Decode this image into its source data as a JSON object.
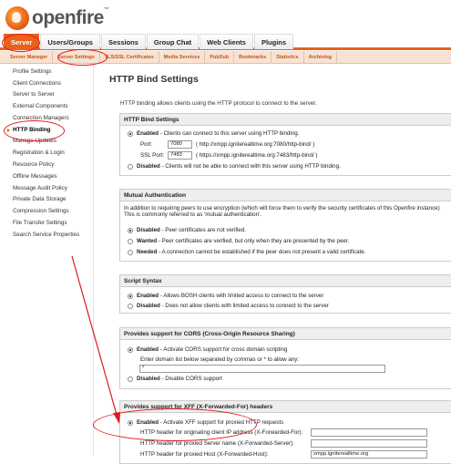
{
  "app": {
    "logo_text": "openfire",
    "logo_tm": "™"
  },
  "main_tabs": [
    "Server",
    "Users/Groups",
    "Sessions",
    "Group Chat",
    "Web Clients",
    "Plugins"
  ],
  "sub_tabs": [
    "Server Manager",
    "Server Settings",
    "TLS/SSL Certificates",
    "Media Services",
    "PubSub",
    "Bookmarks",
    "Statistics",
    "Archiving"
  ],
  "sidebar": {
    "items": [
      "Profile Settings",
      "Client Connections",
      "Server to Server",
      "External Components",
      "Connection Managers",
      "HTTP Binding",
      "Manage Updates",
      "Registration & Login",
      "Resource Policy",
      "Offline Messages",
      "Message Audit Policy",
      "Private Data Storage",
      "Compression Settings",
      "File Transfer Settings",
      "Search Service Properties"
    ]
  },
  "page": {
    "title": "HTTP Bind Settings",
    "intro": "HTTP binding allows clients using the HTTP protocol to connect to the server."
  },
  "http_bind": {
    "header": "HTTP Bind Settings",
    "enabled_label": "Enabled",
    "enabled_desc": " - Clients can connect to this server using HTTP binding.",
    "port_label": "Port:",
    "port_value": "7080",
    "port_url": "( http://xmpp.igniterealtime.org:7080/http-bind/ )",
    "ssl_port_label": "SSL Port:",
    "ssl_port_value": "7483",
    "ssl_port_url": "( https://xmpp.igniterealtime.org:7483/http-bind/ )",
    "disabled_label": "Disabled",
    "disabled_desc": " - Clients will not be able to connect with this server using HTTP binding."
  },
  "mutual_auth": {
    "header": "Mutual Authentication",
    "desc_line1": "In addition to requiring peers to use encryption (which will force them to verify the security certificates of this Openfire instance)",
    "desc_line2": "This is commonly referred to as 'mutual authentication'.",
    "disabled_label": "Disabled",
    "disabled_desc": " - Peer certificates are not verified.",
    "wanted_label": "Wanted",
    "wanted_desc": " - Peer certificates are verified, but only when they are presented by the peer.",
    "needed_label": "Needed",
    "needed_desc": " - A connection cannot be established if the peer does not present a valid certificate."
  },
  "script_syntax": {
    "header": "Script Syntax",
    "enabled_label": "Enabled",
    "enabled_desc": " - Allows BOSH clients with limited access to connect to the server",
    "disabled_label": "Disabled",
    "disabled_desc": " - Does not allow clients with limited access to connect to the server"
  },
  "cors": {
    "header": "Provides support for CORS (Cross-Origin Resource Sharing)",
    "enabled_label": "Enabled",
    "enabled_desc": " - Activate CORS support for cross domain scripting",
    "domain_prompt": "Enter domain list below separated by commas or * to allow any:",
    "domain_value": "*",
    "disabled_label": "Disabled",
    "disabled_desc": " - Disable CORS support"
  },
  "xff": {
    "header": "Provides support for XFF (X-Forwarded-For) headers",
    "enabled_label": "Enabled",
    "enabled_desc": " - Activate XFF support for proxied HTTP requests",
    "client_ip_label": "HTTP header for originating client IP address (X-Forwarded-For):",
    "server_name_label": "HTTP header for proxied Server name (X-Forwarded-Server):",
    "host_label": "HTTP header for proxied Host (X-Forwarded-Host):",
    "host_value": "xmpp.igniterealtime.org"
  },
  "colors": {
    "accent": "#e8621c",
    "annotation": "#e01a1a"
  }
}
